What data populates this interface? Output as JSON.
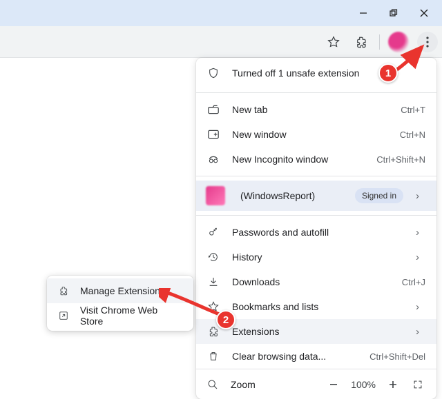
{
  "menu": {
    "safety_notice": "Turned off 1 unsafe extension",
    "new_tab": {
      "label": "New tab",
      "shortcut": "Ctrl+T"
    },
    "new_window": {
      "label": "New window",
      "shortcut": "Ctrl+N"
    },
    "new_incognito": {
      "label": "New Incognito window",
      "shortcut": "Ctrl+Shift+N"
    },
    "profile": {
      "name": "(WindowsReport)",
      "status": "Signed in"
    },
    "passwords": {
      "label": "Passwords and autofill"
    },
    "history": {
      "label": "History"
    },
    "downloads": {
      "label": "Downloads",
      "shortcut": "Ctrl+J"
    },
    "bookmarks": {
      "label": "Bookmarks and lists"
    },
    "extensions": {
      "label": "Extensions"
    },
    "clear_data": {
      "label": "Clear browsing data...",
      "shortcut": "Ctrl+Shift+Del"
    },
    "zoom": {
      "label": "Zoom",
      "value": "100%"
    }
  },
  "submenu": {
    "manage": "Manage Extensions",
    "webstore": "Visit Chrome Web Store"
  },
  "callouts": {
    "one": "1",
    "two": "2"
  }
}
